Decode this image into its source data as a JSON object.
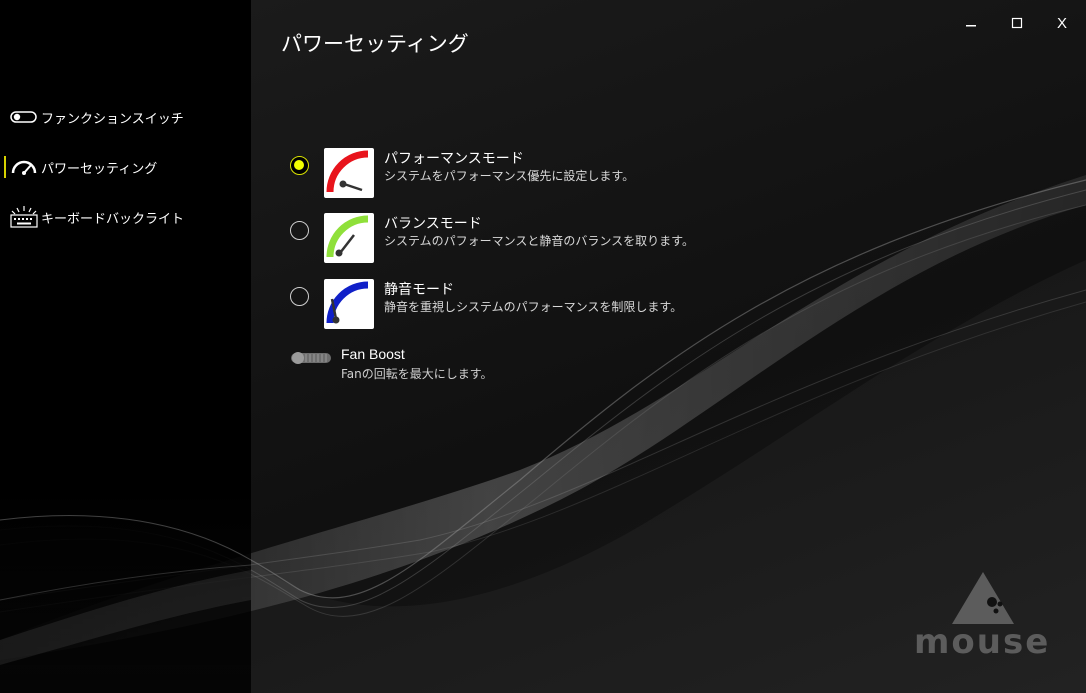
{
  "window": {
    "title": "パワーセッティング",
    "controls": {
      "minimize": "–",
      "maximize": "□",
      "close": "X"
    }
  },
  "sidebar": {
    "items": [
      {
        "label": "ファンクションスイッチ",
        "icon": "toggle-switch-icon",
        "active": false
      },
      {
        "label": "パワーセッティング",
        "icon": "speedometer-icon",
        "active": true
      },
      {
        "label": "キーボードバックライト",
        "icon": "keyboard-backlight-icon",
        "active": false
      }
    ],
    "active_color": "#d6d100"
  },
  "modes": [
    {
      "title": "パフォーマンスモード",
      "description": "システムをパフォーマンス優先に設定します。",
      "icon": "performance-gauge-icon",
      "color": "#e8141c",
      "selected": true
    },
    {
      "title": "バランスモード",
      "description": "システムのパフォーマンスと静音のバランスを取ります。",
      "icon": "balance-gauge-icon",
      "color": "#8fe03a",
      "selected": false
    },
    {
      "title": "静音モード",
      "description": "静音を重視しシステムのパフォーマンスを制限します。",
      "icon": "silent-gauge-icon",
      "color": "#1020c8",
      "selected": false
    }
  ],
  "fan_boost": {
    "title": "Fan Boost",
    "description": "Fanの回転を最大にします。",
    "enabled": false
  },
  "brand": {
    "logo_text": "mouse"
  },
  "colors": {
    "selected_radio": "#f2ff00",
    "background": "#0e0e0e"
  }
}
